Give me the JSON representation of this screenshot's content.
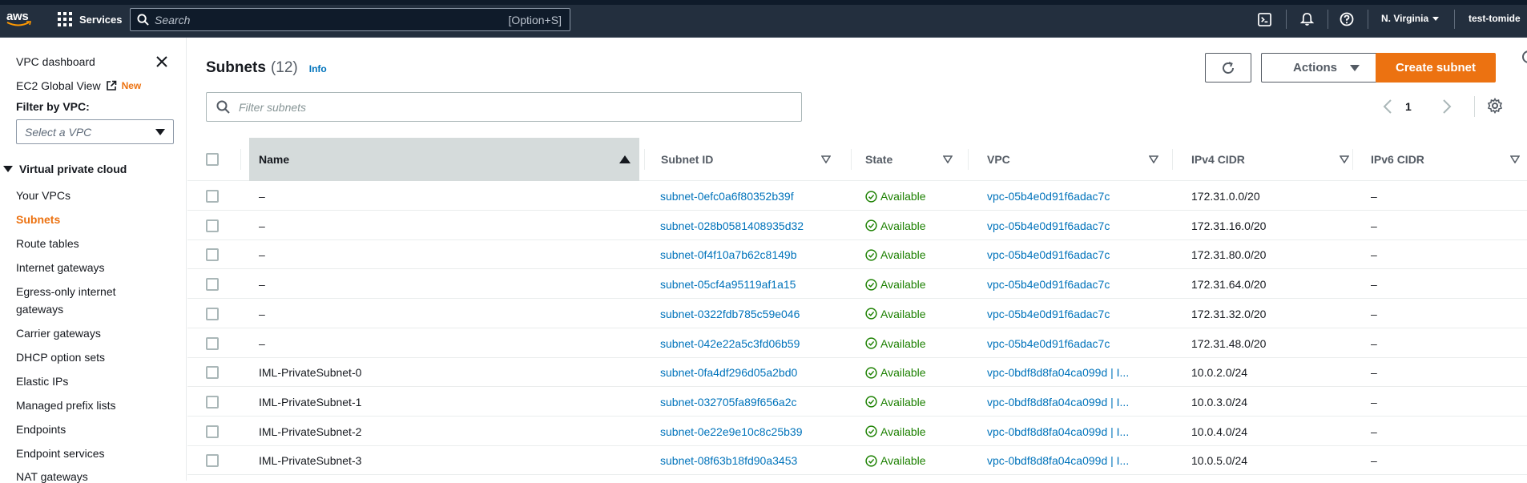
{
  "topnav": {
    "logo": "aws",
    "services_label": "Services",
    "search_placeholder": "Search",
    "search_shortcut": "[Option+S]",
    "region": "N. Virginia",
    "account": "test-tomide"
  },
  "sidebar": {
    "vpc_dashboard": "VPC dashboard",
    "ec2_global_view": "EC2 Global View",
    "new_badge": "New",
    "filter_label": "Filter by VPC:",
    "select_placeholder": "Select a VPC",
    "section_title": "Virtual private cloud",
    "items": [
      {
        "label": "Your VPCs"
      },
      {
        "label": "Subnets"
      },
      {
        "label": "Route tables"
      },
      {
        "label": "Internet gateways"
      },
      {
        "label": "Egress-only internet"
      },
      {
        "label": "gateways"
      },
      {
        "label": "Carrier gateways"
      },
      {
        "label": "DHCP option sets"
      },
      {
        "label": "Elastic IPs"
      },
      {
        "label": "Managed prefix lists"
      },
      {
        "label": "Endpoints"
      },
      {
        "label": "Endpoint services"
      },
      {
        "label": "NAT gateways"
      }
    ]
  },
  "main": {
    "title": "Subnets",
    "count": "(12)",
    "info": "Info",
    "actions_label": "Actions",
    "create_label": "Create subnet",
    "filter_placeholder": "Filter subnets",
    "page": "1",
    "columns": [
      "Name",
      "Subnet ID",
      "State",
      "VPC",
      "IPv4 CIDR",
      "IPv6 CIDR"
    ],
    "rows": [
      {
        "name": "–",
        "subnet_id": "subnet-0efc0a6f80352b39f",
        "state": "Available",
        "vpc": "vpc-05b4e0d91f6adac7c",
        "ipv4": "172.31.0.0/20",
        "ipv6": "–"
      },
      {
        "name": "–",
        "subnet_id": "subnet-028b0581408935d32",
        "state": "Available",
        "vpc": "vpc-05b4e0d91f6adac7c",
        "ipv4": "172.31.16.0/20",
        "ipv6": "–"
      },
      {
        "name": "–",
        "subnet_id": "subnet-0f4f10a7b62c8149b",
        "state": "Available",
        "vpc": "vpc-05b4e0d91f6adac7c",
        "ipv4": "172.31.80.0/20",
        "ipv6": "–"
      },
      {
        "name": "–",
        "subnet_id": "subnet-05cf4a95119af1a15",
        "state": "Available",
        "vpc": "vpc-05b4e0d91f6adac7c",
        "ipv4": "172.31.64.0/20",
        "ipv6": "–"
      },
      {
        "name": "–",
        "subnet_id": "subnet-0322fdb785c59e046",
        "state": "Available",
        "vpc": "vpc-05b4e0d91f6adac7c",
        "ipv4": "172.31.32.0/20",
        "ipv6": "–"
      },
      {
        "name": "–",
        "subnet_id": "subnet-042e22a5c3fd06b59",
        "state": "Available",
        "vpc": "vpc-05b4e0d91f6adac7c",
        "ipv4": "172.31.48.0/20",
        "ipv6": "–"
      },
      {
        "name": "IML-PrivateSubnet-0",
        "subnet_id": "subnet-0fa4df296d05a2bd0",
        "state": "Available",
        "vpc": "vpc-0bdf8d8fa04ca099d | I...",
        "ipv4": "10.0.2.0/24",
        "ipv6": "–"
      },
      {
        "name": "IML-PrivateSubnet-1",
        "subnet_id": "subnet-032705fa89f656a2c",
        "state": "Available",
        "vpc": "vpc-0bdf8d8fa04ca099d | I...",
        "ipv4": "10.0.3.0/24",
        "ipv6": "–"
      },
      {
        "name": "IML-PrivateSubnet-2",
        "subnet_id": "subnet-0e22e9e10c8c25b39",
        "state": "Available",
        "vpc": "vpc-0bdf8d8fa04ca099d | I...",
        "ipv4": "10.0.4.0/24",
        "ipv6": "–"
      },
      {
        "name": "IML-PrivateSubnet-3",
        "subnet_id": "subnet-08f63b18fd90a3453",
        "state": "Available",
        "vpc": "vpc-0bdf8d8fa04ca099d | I...",
        "ipv4": "10.0.5.0/24",
        "ipv6": "–"
      }
    ]
  },
  "colors": {
    "nav_bg": "#232f3e",
    "accent": "#ec7211",
    "link": "#0073bb",
    "available": "#1d8102"
  }
}
